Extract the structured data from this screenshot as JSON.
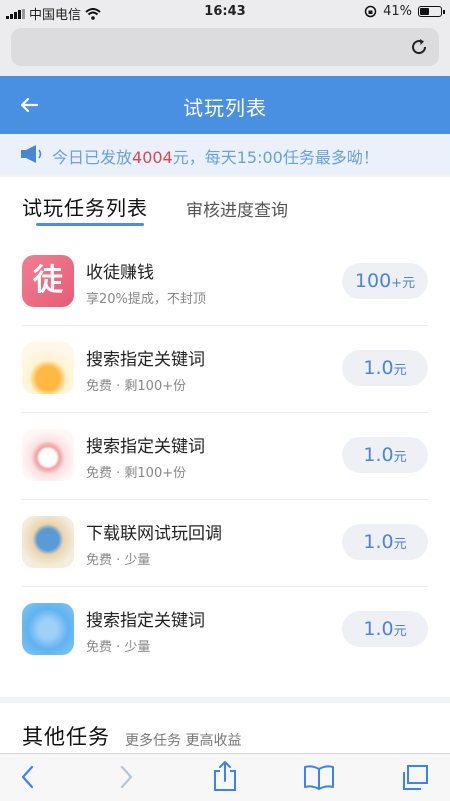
{
  "status": {
    "carrier": "中国电信",
    "time": "16:43",
    "battery": "41%",
    "battery_level": 0.41
  },
  "header": {
    "title": "试玩列表"
  },
  "notice": {
    "prefix": "今日已发放",
    "count": "4004",
    "suffix": "元，每天15:00任务最多呦！"
  },
  "tabs": [
    {
      "label": "试玩任务列表"
    },
    {
      "label": "审核进度查询"
    }
  ],
  "tasks": [
    {
      "title": "收徒赚钱",
      "subtitle": "享20%提成，不封顶",
      "reward": "100",
      "unit": "+元",
      "icon": "tu-icon",
      "icon_text": "徒"
    },
    {
      "title": "搜索指定关键词",
      "subtitle": "免费 · 剩100+份",
      "reward": "1.0",
      "unit": "元",
      "icon": "sun-app-icon"
    },
    {
      "title": "搜索指定关键词",
      "subtitle": "免费 · 剩100+份",
      "reward": "1.0",
      "unit": "元",
      "icon": "ring-app-icon"
    },
    {
      "title": "下载联网试玩回调",
      "subtitle": "免费 · 少量",
      "reward": "1.0",
      "unit": "元",
      "icon": "globe-app-icon"
    },
    {
      "title": "搜索指定关键词",
      "subtitle": "免费 · 少量",
      "reward": "1.0",
      "unit": "元",
      "icon": "blue-app-icon"
    }
  ],
  "other": {
    "title": "其他任务",
    "subtitle": "更多任务 更高收益"
  },
  "colors": {
    "primary": "#4a90e2",
    "accent_red": "#e0454f",
    "notice_text": "#6aa1dc"
  }
}
